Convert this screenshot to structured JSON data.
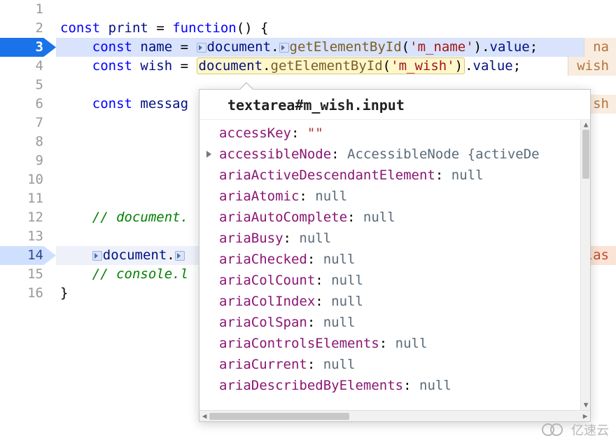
{
  "editor": {
    "lines": [
      {
        "n": "1"
      },
      {
        "n": "2"
      },
      {
        "n": "3",
        "active": true
      },
      {
        "n": "4"
      },
      {
        "n": "5"
      },
      {
        "n": "6"
      },
      {
        "n": "7"
      },
      {
        "n": "8"
      },
      {
        "n": "9"
      },
      {
        "n": "10"
      },
      {
        "n": "11"
      },
      {
        "n": "12"
      },
      {
        "n": "13"
      },
      {
        "n": "14",
        "faint": true
      },
      {
        "n": "15"
      },
      {
        "n": "16"
      }
    ],
    "code": {
      "l2": {
        "const": "const",
        "print": "print",
        "eq": "=",
        "func": "function",
        "open": "() {"
      },
      "l3": {
        "indent": "    ",
        "const": "const",
        "name": "name",
        "eq": "=",
        "doc": "document",
        "dot": ".",
        "get": "getElementById",
        "open": "(",
        "arg": "'m_name'",
        "close": ")",
        "dot2": ".",
        "val": "value",
        "semi": ";"
      },
      "l4": {
        "indent": "    ",
        "const": "const",
        "name": "wish",
        "eq": "=",
        "doc": "document",
        "dot": ".",
        "get": "getElementById",
        "open": "(",
        "arg": "'m_wish'",
        "close": ")",
        "dot2": ".",
        "val": "value",
        "semi": ";"
      },
      "l6": {
        "indent": "    ",
        "const": "const",
        "name": "messag"
      },
      "l12": {
        "indent": "    ",
        "text": "// document."
      },
      "l14": {
        "indent": "    ",
        "doc": "document",
        "dot": "."
      },
      "l15": {
        "indent": "    ",
        "text": "// console.l"
      },
      "l16": {
        "close": "}"
      }
    },
    "chips": {
      "l3": "na",
      "l4": "wish",
      "l6": "sh",
      "l14": "las"
    }
  },
  "tooltip": {
    "header": "textarea#m_wish.input",
    "props": [
      {
        "name": "accessKey",
        "value": "\"\"",
        "kind": "str"
      },
      {
        "name": "accessibleNode",
        "value": "AccessibleNode {activeDe",
        "kind": "obj",
        "expandable": true
      },
      {
        "name": "ariaActiveDescendantElement",
        "value": "null",
        "kind": "null"
      },
      {
        "name": "ariaAtomic",
        "value": "null",
        "kind": "null"
      },
      {
        "name": "ariaAutoComplete",
        "value": "null",
        "kind": "null"
      },
      {
        "name": "ariaBusy",
        "value": "null",
        "kind": "null"
      },
      {
        "name": "ariaChecked",
        "value": "null",
        "kind": "null"
      },
      {
        "name": "ariaColCount",
        "value": "null",
        "kind": "null"
      },
      {
        "name": "ariaColIndex",
        "value": "null",
        "kind": "null"
      },
      {
        "name": "ariaColSpan",
        "value": "null",
        "kind": "null"
      },
      {
        "name": "ariaControlsElements",
        "value": "null",
        "kind": "null"
      },
      {
        "name": "ariaCurrent",
        "value": "null",
        "kind": "null"
      },
      {
        "name": "ariaDescribedByElements",
        "value": "null",
        "kind": "null"
      }
    ]
  },
  "watermark": "亿速云"
}
